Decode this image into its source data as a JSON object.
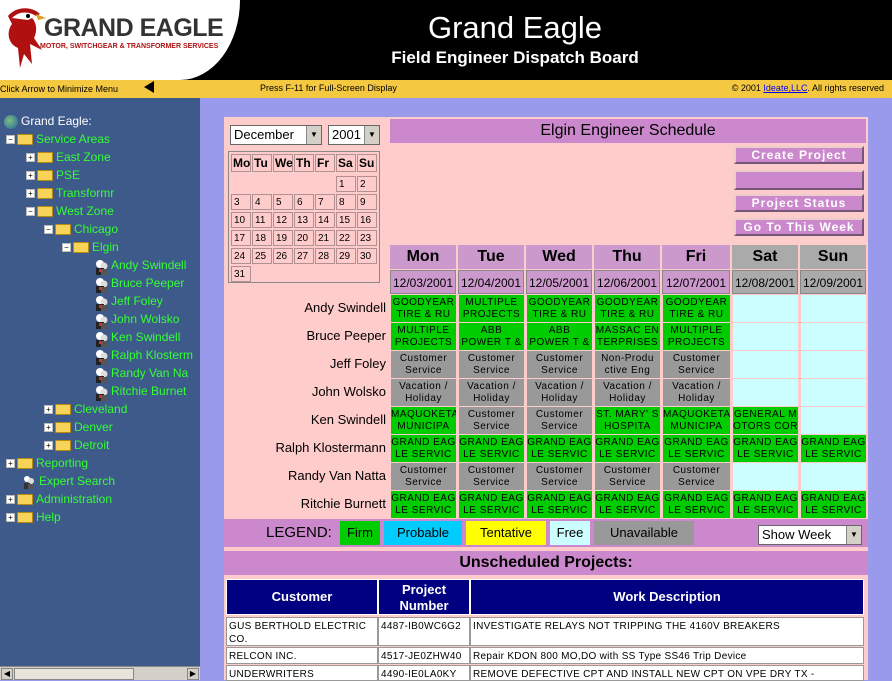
{
  "header": {
    "logo_title": "GRAND EAGLE",
    "logo_subtitle": "MOTOR, SWITCHGEAR & TRANSFORMER SERVICES",
    "title": "Grand Eagle",
    "subtitle": "Field Engineer Dispatch Board"
  },
  "topbar": {
    "minimize_text": "Click Arrow to Minimize Menu",
    "fullscreen_text": "Press F-11 for Full-Screen Display",
    "copyright_prefix": "© 2001 ",
    "copyright_link": "Ideate,LLC",
    "copyright_suffix": ". All rights reserved"
  },
  "tree": {
    "root": "Grand Eagle:",
    "service_areas": "Service Areas",
    "east_zone": "East Zone",
    "pse": "PSE",
    "transformr": "Transformr",
    "west_zone": "West Zone",
    "chicago": "Chicago",
    "elgin": "Elgin",
    "engineers": [
      "Andy Swindell",
      "Bruce Peeper",
      "Jeff Foley",
      "John Wolsko",
      "Ken Swindell",
      "Ralph Klosterm",
      "Randy Van Na",
      "Ritchie Burnet"
    ],
    "cleveland": "Cleveland",
    "denver": "Denver",
    "detroit": "Detroit",
    "reporting": "Reporting",
    "expert_search": "Expert Search",
    "administration": "Administration",
    "help": "Help"
  },
  "calendar": {
    "month": "December",
    "year": "2001",
    "weekday_headers": [
      "Mo",
      "Tu",
      "We",
      "Th",
      "Fr",
      "Sa",
      "Su"
    ],
    "days": [
      "",
      "",
      "",
      "",
      "",
      "1",
      "2",
      "3",
      "4",
      "5",
      "6",
      "7",
      "8",
      "9",
      "10",
      "11",
      "12",
      "13",
      "14",
      "15",
      "16",
      "17",
      "18",
      "19",
      "20",
      "21",
      "22",
      "23",
      "24",
      "25",
      "26",
      "27",
      "28",
      "29",
      "30",
      "31"
    ]
  },
  "schedule": {
    "title": "Elgin Engineer Schedule",
    "buttons": {
      "create_project": "Create Project",
      "project_status": "Project Status",
      "go_to_week": "Go To This Week"
    },
    "days": [
      "Mon",
      "Tue",
      "Wed",
      "Thu",
      "Fri",
      "Sat",
      "Sun"
    ],
    "dates": [
      "12/03/2001",
      "12/04/2001",
      "12/05/2001",
      "12/06/2001",
      "12/07/2001",
      "12/08/2001",
      "12/09/2001"
    ],
    "rows": [
      {
        "name": "Andy Swindell",
        "cells": [
          {
            "text": "GOODYEAR TIRE & RU",
            "status": "firm"
          },
          {
            "text": "MULTIPLE PROJECTS",
            "status": "firm"
          },
          {
            "text": "GOODYEAR TIRE & RU",
            "status": "firm"
          },
          {
            "text": "GOODYEAR TIRE & RU",
            "status": "firm"
          },
          {
            "text": "GOODYEAR TIRE & RU",
            "status": "firm"
          },
          {
            "text": "",
            "status": "free"
          },
          {
            "text": "",
            "status": "free"
          }
        ]
      },
      {
        "name": "Bruce Peeper",
        "cells": [
          {
            "text": "MULTIPLE PROJECTS",
            "status": "firm"
          },
          {
            "text": "ABB POWER T & D CO",
            "status": "firm"
          },
          {
            "text": "ABB POWER T & D CO",
            "status": "firm"
          },
          {
            "text": "MASSAC EN TERPRISES",
            "status": "firm"
          },
          {
            "text": "MULTIPLE PROJECTS",
            "status": "firm"
          },
          {
            "text": "",
            "status": "free"
          },
          {
            "text": "",
            "status": "free"
          }
        ]
      },
      {
        "name": "Jeff Foley",
        "cells": [
          {
            "text": "Customer Service",
            "status": "unavailable"
          },
          {
            "text": "Customer Service",
            "status": "unavailable"
          },
          {
            "text": "Customer Service",
            "status": "unavailable"
          },
          {
            "text": "Non-Produ ctive Eng",
            "status": "unavailable"
          },
          {
            "text": "Customer Service",
            "status": "unavailable"
          },
          {
            "text": "",
            "status": "free"
          },
          {
            "text": "",
            "status": "free"
          }
        ]
      },
      {
        "name": "John Wolsko",
        "cells": [
          {
            "text": "Vacation / Holiday",
            "status": "unavailable"
          },
          {
            "text": "Vacation / Holiday",
            "status": "unavailable"
          },
          {
            "text": "Vacation / Holiday",
            "status": "unavailable"
          },
          {
            "text": "Vacation / Holiday",
            "status": "unavailable"
          },
          {
            "text": "Vacation / Holiday",
            "status": "unavailable"
          },
          {
            "text": "",
            "status": "free"
          },
          {
            "text": "",
            "status": "free"
          }
        ]
      },
      {
        "name": "Ken Swindell",
        "cells": [
          {
            "text": "MAQUOKETA MUNICIPA",
            "status": "firm"
          },
          {
            "text": "Customer Service",
            "status": "unavailable"
          },
          {
            "text": "Customer Service",
            "status": "unavailable"
          },
          {
            "text": "ST. MARY' S HOSPITA",
            "status": "firm"
          },
          {
            "text": "MAQUOKETA MUNICIPA",
            "status": "firm"
          },
          {
            "text": "GENERAL M OTORS COR",
            "status": "firm"
          },
          {
            "text": "",
            "status": "free"
          }
        ]
      },
      {
        "name": "Ralph Klostermann",
        "cells": [
          {
            "text": "GRAND EAG LE SERVIC",
            "status": "firm"
          },
          {
            "text": "GRAND EAG LE SERVIC",
            "status": "firm"
          },
          {
            "text": "GRAND EAG LE SERVIC",
            "status": "firm"
          },
          {
            "text": "GRAND EAG LE SERVIC",
            "status": "firm"
          },
          {
            "text": "GRAND EAG LE SERVIC",
            "status": "firm"
          },
          {
            "text": "GRAND EAG LE SERVIC",
            "status": "firm"
          },
          {
            "text": "GRAND EAG LE SERVIC",
            "status": "firm"
          }
        ]
      },
      {
        "name": "Randy Van Natta",
        "cells": [
          {
            "text": "Customer Service",
            "status": "unavailable"
          },
          {
            "text": "Customer Service",
            "status": "unavailable"
          },
          {
            "text": "Customer Service",
            "status": "unavailable"
          },
          {
            "text": "Customer Service",
            "status": "unavailable"
          },
          {
            "text": "Customer Service",
            "status": "unavailable"
          },
          {
            "text": "",
            "status": "free"
          },
          {
            "text": "",
            "status": "free"
          }
        ]
      },
      {
        "name": "Ritchie Burnett",
        "cells": [
          {
            "text": "GRAND EAG LE SERVIC",
            "status": "firm"
          },
          {
            "text": "GRAND EAG LE SERVIC",
            "status": "firm"
          },
          {
            "text": "GRAND EAG LE SERVIC",
            "status": "firm"
          },
          {
            "text": "GRAND EAG LE SERVIC",
            "status": "firm"
          },
          {
            "text": "GRAND EAG LE SERVIC",
            "status": "firm"
          },
          {
            "text": "GRAND EAG LE SERVIC",
            "status": "firm"
          },
          {
            "text": "GRAND EAG LE SERVIC",
            "status": "firm"
          }
        ]
      }
    ]
  },
  "legend": {
    "label": "LEGEND:",
    "items": [
      {
        "label": "Firm",
        "color": "#00cc00"
      },
      {
        "label": "Probable",
        "color": "#00ccff"
      },
      {
        "label": "Tentative",
        "color": "#ffff00"
      },
      {
        "label": "Free",
        "color": "#ccffff"
      },
      {
        "label": "Unavailable",
        "color": "#999999"
      }
    ],
    "view_select": "Show Week"
  },
  "unscheduled": {
    "title": "Unscheduled Projects:",
    "headers": [
      "Customer",
      "Project Number",
      "Work Description"
    ],
    "rows": [
      [
        "GUS BERTHOLD ELECTRIC CO.",
        "4487-IB0WC6G2",
        "INVESTIGATE RELAYS NOT TRIPPING THE 4160V BREAKERS"
      ],
      [
        "RELCON INC.",
        "4517-JE0ZHW40",
        "Repair KDON 800 MO,DO with SS Type SS46 Trip Device"
      ],
      [
        "UNDERWRITERS",
        "4490-IE0LA0KY",
        "REMOVE DEFECTIVE CPT AND INSTALL NEW CPT ON VPE DRY TX -"
      ]
    ]
  },
  "colors": {
    "firm": "#00cc00",
    "free": "#ccffff",
    "unavailable": "#999999",
    "weekday_header": "#cc99cc",
    "weekend_header": "#aaaaaa"
  }
}
